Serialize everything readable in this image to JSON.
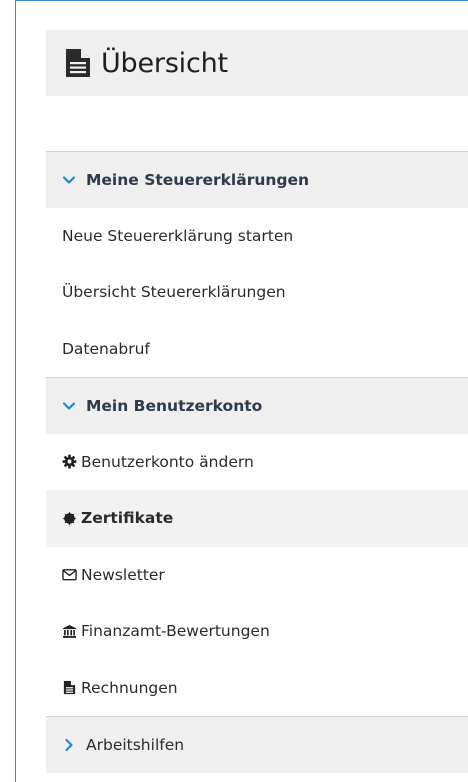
{
  "header": {
    "title": "Übersicht",
    "icon": "document-icon"
  },
  "sections": {
    "steuer": {
      "label": "Meine Steuererklärungen",
      "icon": "chevron-down-icon",
      "expanded": true,
      "items": [
        {
          "label": "Neue Steuererklärung starten"
        },
        {
          "label": "Übersicht Steuererklärungen"
        },
        {
          "label": "Datenabruf"
        }
      ]
    },
    "konto": {
      "label": "Mein Benutzerkonto",
      "icon": "chevron-down-icon",
      "expanded": true,
      "items": [
        {
          "label": "Benutzerkonto ändern",
          "icon": "gear-icon"
        },
        {
          "label": "Zertifikate",
          "icon": "certificate-icon",
          "active": true
        },
        {
          "label": "Newsletter",
          "icon": "envelope-icon"
        },
        {
          "label": "Finanzamt-Bewertungen",
          "icon": "bank-icon"
        },
        {
          "label": "Rechnungen",
          "icon": "document-icon"
        }
      ]
    },
    "arbeitshilfen": {
      "label": "Arbeitshilfen",
      "icon": "chevron-right-icon",
      "expanded": false
    }
  },
  "colors": {
    "accent": "#1a8ad4",
    "section_bg": "#efefef",
    "frame_border": "#3a86c8"
  }
}
